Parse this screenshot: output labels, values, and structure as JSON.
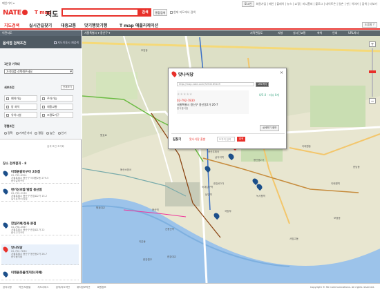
{
  "topbar": {
    "left_text": "메인가기 ▾",
    "login": "로그인",
    "links": "회원가입 | 메인 | 플레이 | 뉴스 | 쇼핑 | 미니홈피 | 블로그 | 네이트온 | 일촌 | 판 | 이야기 | 검색 | 더보기"
  },
  "header": {
    "nate": "NATE",
    "tmap": "T map",
    "jido": "지도",
    "search_value": "",
    "search_button": "검색",
    "total_search": "통합검색",
    "current_view_search": "현재 지도에서 검색"
  },
  "nav": {
    "tabs": [
      "지도검색",
      "실시간길찾기",
      "대중교통",
      "맛기행맛기행",
      "T map 애플리케이션"
    ],
    "help": "도움말 ?"
  },
  "left": {
    "nav_title": "이전지도",
    "panel_title": "음식점 검색조건",
    "panel_check": "지도이동시 재검색",
    "price_label": "1인당 가격대",
    "price_select": "가격대를 선택해주세요",
    "detail_label": "세부조건",
    "detail_select": "전체보기",
    "options": [
      "예약가능",
      "주차가능",
      "방 좌석",
      "대중교통",
      "유아시설",
      "조명&가구"
    ],
    "sort_label": "정렬조건",
    "sort_options": [
      "정확",
      "가까운거리",
      "평점",
      "높은",
      "인기"
    ],
    "clear_link": "검색 조건 초기화",
    "results_title": "장소 검색결과 · 8",
    "results": [
      {
        "name": "이태원갈비구이 2호점",
        "meta": "02-795-6324\n서울특별시 용산구 이태원2동 279-5\n한식갈비구이"
      },
      {
        "name": "펀기산초밥/덮밥 용산점",
        "meta": "02-795-5130\n서울특별시 용산구 한강로2가 15-2\n일식돈까스/덮밥"
      },
      {
        "name": "한일카페/정육 본점",
        "meta": "02-798-4567\n서울특별시 용산구 한강로1가 22\n한식고기구이"
      },
      {
        "name": "맛나식당",
        "meta": "02-792-7830\n서울특별시 용산구 용산동2가 26-7\n한식음식점"
      },
      {
        "name": "이태원웃을래가든(카페)",
        "meta": ""
      }
    ]
  },
  "map": {
    "toolbar_left": "서울특별시 ▾   용산구 ▾",
    "toolbar_items": [
      "지적편집도",
      "지형",
      "실시간교통",
      "축척",
      "인쇄",
      "URL복사"
    ],
    "popup": {
      "title": "맛나식당",
      "url": "http://map.nate.com/?#52165149",
      "copy": "URL복사",
      "rating": "0/5.0 · 리뷰 0개",
      "tel": "02-792-7830",
      "address": "서울특별시 용산구 용산동2가 26-7",
      "category": "한식음식점",
      "detail": "상세보기 정보",
      "findway_label": "길찾기",
      "start_label": "맛나식당 출발",
      "end_placeholder": "도착지 입력",
      "go": "검색"
    },
    "labels": [
      "남영역",
      "숙대입구역",
      "용산역",
      "삼각지역",
      "녹사평역",
      "이태원역",
      "신용산역",
      "용산우체국",
      "한강로3가",
      "이촌동",
      "원효로",
      "용산동2가",
      "후암동",
      "한남동",
      "보광동",
      "서빙고동",
      "이태원동",
      "한강대교",
      "원효대교",
      "한강철교",
      "용산소방서",
      "국방부"
    ],
    "pins": [
      "A",
      "B",
      "C",
      "D",
      "E"
    ]
  },
  "footer": {
    "links": [
      "공지사항",
      "약관/도움말",
      "지도서비스",
      "검색/지도약관",
      "위치정보약관",
      "회원정보"
    ],
    "copyright": "Copyright © SK Communications. All rights reserved."
  },
  "colors": {
    "accent": "#e8302a",
    "panel": "#4f5a63",
    "pin": "#1c4f8a",
    "map_bg": "#dde0c6"
  }
}
